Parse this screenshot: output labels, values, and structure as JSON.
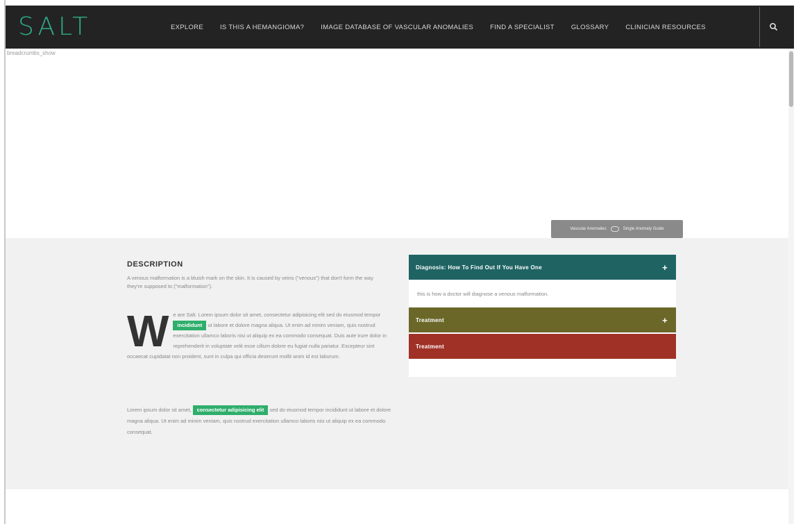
{
  "brand": {
    "logo": "SALT",
    "accent": "#2fae8a"
  },
  "nav": {
    "items": [
      "EXPLORE",
      "IS THIS A HEMANGIOMA?",
      "IMAGE DATABASE OF VASCULAR ANOMALIES",
      "FIND A SPECIALIST",
      "GLOSSARY",
      "CLINICIAN RESOURCES"
    ],
    "search_icon": "search-icon"
  },
  "breadcrumbs": "breadcrumbs_show",
  "toggle": {
    "left_label": "Vascular Anomalies",
    "right_label": "Single Anomaly Guide"
  },
  "description": {
    "heading": "DESCRIPTION",
    "intro": "A venous malformation is a bluish mark on the skin. It is caused by veins (\"venous\") that don't form the way they're supposed to (\"malformation\").",
    "dropcap": "W",
    "para1_a": "e are Salt. Lorem ipsum dolor sit amet, consectetur adipisicing elit sed do eiusmod tempor ",
    "tag1": "incididunt",
    "para1_b": " ut labore et dolore magna aliqua. Ut enim ad minim veniam, quis nostrud exercitation ullamco laboris nisi ut aliquip ex ea commodo consequat. Duis aute irure dolor in reprehenderit in voluptate velit esse cillum dolore eu fugiat nulla pariatur. Excepteur sint occaecat cupidatat non proident, sunt in culpa qui officia deserunt mollit anim id est laborum.",
    "para2_a": "Lorem ipsum dolor sit amet, ",
    "tag2": "consectetur adipisicing elit",
    "para2_b": " sed do eiusmod tempor incididunt ut labore et dolore magna aliqua. Ut enim ad minim veniam, quis nostrud exercitation ullamco laboris nisi ut aliquip ex ea commodo consequat."
  },
  "accordion": {
    "diagnosis": {
      "title": "Diagnosis: How To Find Out If You Have One",
      "body": "this is how a doctor will diagnose a venous malformation.",
      "color": "#1f6363"
    },
    "treatment1": {
      "title": "Treatment",
      "color": "#6a6729"
    },
    "treatment2": {
      "title": "Treatment",
      "color": "#a03126"
    },
    "plus": "+"
  }
}
